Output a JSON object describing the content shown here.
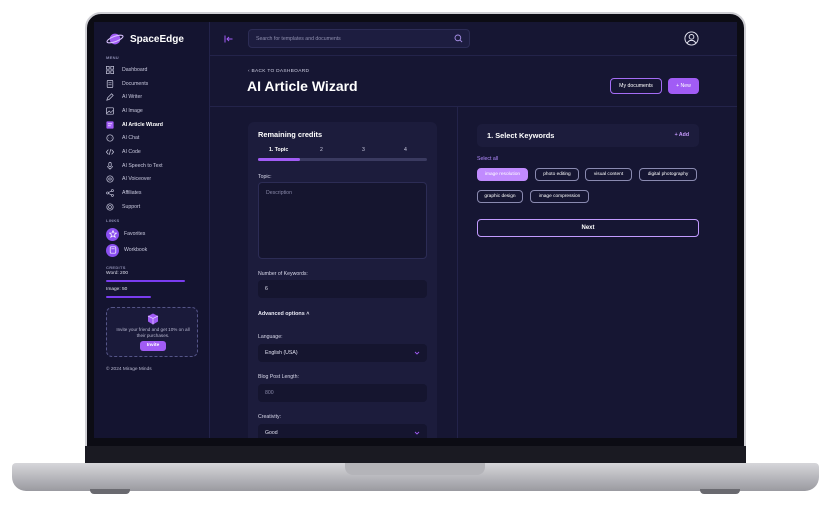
{
  "app": {
    "name": "SpaceEdge"
  },
  "colors": {
    "accent": "#a15cf5",
    "background": "#161633",
    "panel": "#1c1c3c"
  },
  "sidebar": {
    "menu_label": "MENU",
    "items": [
      {
        "label": "Dashboard",
        "icon": "grid-icon"
      },
      {
        "label": "Documents",
        "icon": "document-icon"
      },
      {
        "label": "AI Writer",
        "icon": "pen-icon"
      },
      {
        "label": "AI Image",
        "icon": "image-icon"
      },
      {
        "label": "AI Article Wizard",
        "icon": "wizard-icon",
        "active": true
      },
      {
        "label": "AI Chat",
        "icon": "chat-icon"
      },
      {
        "label": "AI Code",
        "icon": "code-icon"
      },
      {
        "label": "AI Speech to Text",
        "icon": "microphone-icon"
      },
      {
        "label": "AI Voiceover",
        "icon": "voiceover-icon"
      },
      {
        "label": "Affiliates",
        "icon": "share-icon"
      },
      {
        "label": "Support",
        "icon": "support-icon"
      }
    ],
    "links_label": "LINKS",
    "links": [
      {
        "label": "Favorites",
        "icon": "star-icon"
      },
      {
        "label": "Workbook",
        "icon": "book-icon"
      }
    ],
    "credits_label": "CREDITS",
    "credits": {
      "word_label": "Word: 200",
      "word_fraction": 0.98,
      "image_label": "Image: 50",
      "image_fraction": 0.55
    },
    "invite": {
      "text": "Invite your friend and get 10% on all their purchases.",
      "button": "Invite"
    },
    "copyright": "© 2024 Mirage Minds"
  },
  "header": {
    "search_placeholder": "Search for templates and documents"
  },
  "page": {
    "back_label": "BACK TO DASHBOARD",
    "title": "AI Article Wizard",
    "my_documents_label": "My documents",
    "new_label": "New"
  },
  "wizard": {
    "title": "Remaining credits",
    "steps": [
      "1. Topic",
      "2",
      "3",
      "4"
    ],
    "progress_fraction": 0.25,
    "topic_label": "Topic:",
    "topic_placeholder": "Description",
    "keywords_label": "Number of Keywords:",
    "keywords_value": "6",
    "advanced_label": "Advanced options",
    "language_label": "Language:",
    "language_value": "English (USA)",
    "length_label": "Blog Post Length:",
    "length_placeholder": "800",
    "creativity_label": "Creativity:",
    "creativity_value": "Good"
  },
  "keywords": {
    "title": "1. Select Keywords",
    "add_label": "Add",
    "select_all_label": "Select all",
    "tags": [
      {
        "label": "image resolution",
        "selected": true
      },
      {
        "label": "photo editing",
        "selected": false
      },
      {
        "label": "visual content",
        "selected": false
      },
      {
        "label": "digital photography",
        "selected": false
      },
      {
        "label": "graphic design",
        "selected": false
      },
      {
        "label": "image compression",
        "selected": false
      }
    ],
    "next_label": "Next"
  }
}
